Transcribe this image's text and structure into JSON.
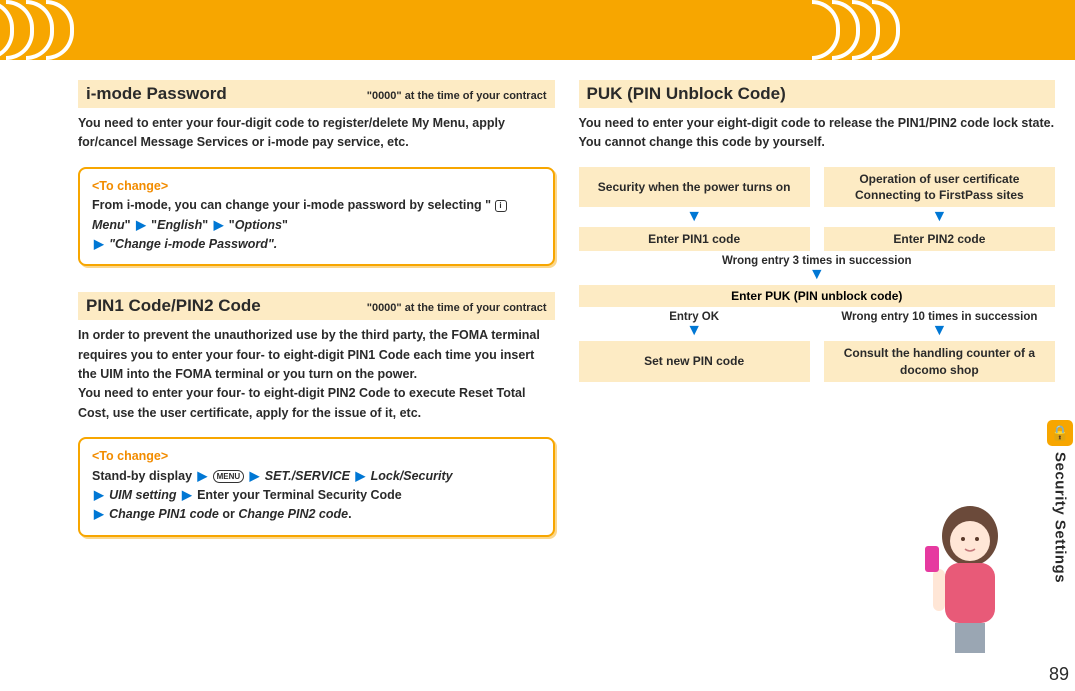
{
  "sideTab": {
    "label": "Security Settings"
  },
  "pageNumber": "89",
  "left": {
    "imode": {
      "title": "i-mode Password",
      "note": "\"0000\" at the time of your contract",
      "body": "You need to enter your four-digit code to register/delete My Menu, apply for/cancel Message Services or i-mode pay service, etc.",
      "change": {
        "title": "<To change>",
        "line1": "From i-mode, you can change your i-mode password by selecting \"",
        "menuIcon": "i",
        "menu": "Menu",
        "q1": "\"",
        "english": "English",
        "q2": "\"",
        "options": "Options",
        "q3": "\"",
        "line2a": "\"",
        "line2b": "Change i-mode Password",
        "line2c": "\"."
      }
    },
    "pin": {
      "title": "PIN1 Code/PIN2 Code",
      "note": "\"0000\" at the time of your contract",
      "body": "In order to prevent the unauthorized use by the third party, the FOMA terminal requires you to enter your four- to eight-digit PIN1 Code each time you insert the UIM into the FOMA terminal or you turn on the power.\nYou need to enter your four- to eight-digit PIN2 Code to execute Reset Total Cost, use the user certificate, apply for the issue of it, etc.",
      "change": {
        "title": "<To change>",
        "standby": "Stand-by display",
        "menuBtn": "MENU",
        "setservice": "SET./SERVICE",
        "locksec": "Lock/Security",
        "uim": "UIM setting",
        "enterCode": "Enter your Terminal Security Code",
        "cp1": "Change PIN1 code",
        "or": " or ",
        "cp2": "Change PIN2 code",
        "dot": "."
      }
    }
  },
  "right": {
    "puk": {
      "title": "PUK (PIN Unblock Code)",
      "body": "You need to enter your eight-digit code to release the PIN1/PIN2 code lock state. You cannot change this code by yourself."
    },
    "flow": {
      "topLeft": "Security when the power turns on",
      "topRight": "Operation of user certificate Connecting to FirstPass sites",
      "enterPin1": "Enter PIN1 code",
      "enterPin2": "Enter PIN2 code",
      "wrong3": "Wrong entry 3 times in succession",
      "enterPuk": "Enter PUK (PIN unblock code)",
      "entryOk": "Entry OK",
      "wrong10": "Wrong entry 10 times in succession",
      "setNew": "Set new PIN code",
      "consult": "Consult the handling counter of a docomo shop"
    }
  }
}
